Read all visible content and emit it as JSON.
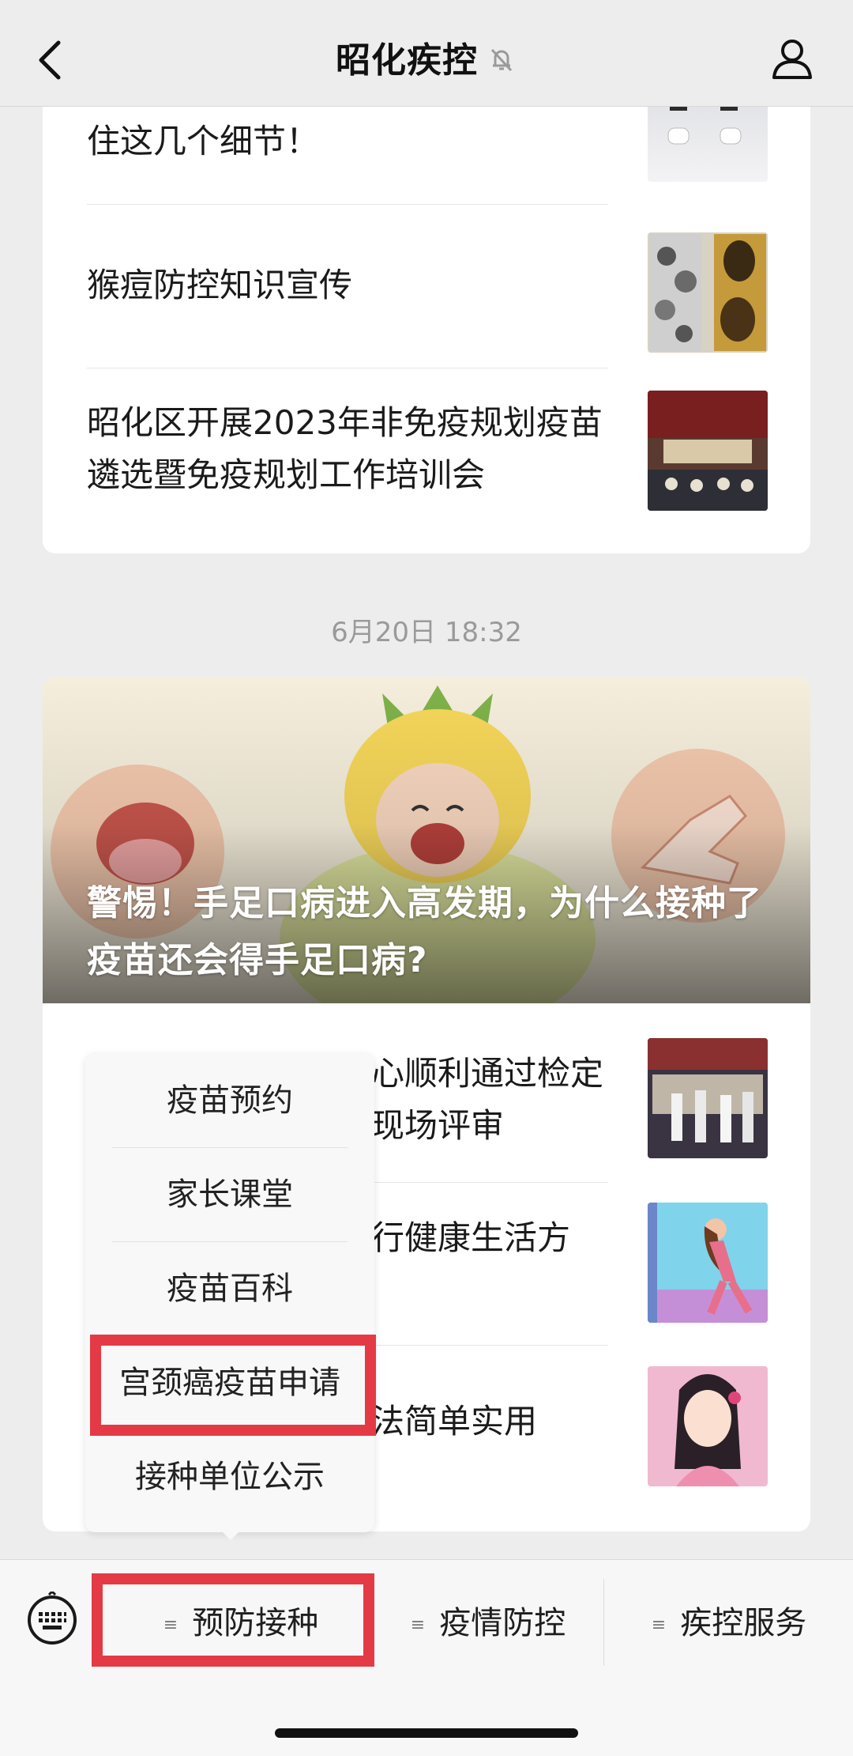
{
  "nav": {
    "title": "昭化疾控"
  },
  "articles_top": [
    {
      "title": "住这几个细节！"
    },
    {
      "title": "猴痘防控知识宣传"
    },
    {
      "title": "昭化区开展2023年非免疫规划疫苗遴选暨免疫规划工作培训会"
    }
  ],
  "timestamp": "6月20日 18:32",
  "hero": {
    "title": "警惕！手足口病进入高发期，为什么接种了疫苗还会得手足口病?"
  },
  "articles_bottom": [
    {
      "title_visible": "心顺利通过检定现场评审"
    },
    {
      "title_visible": "行健康生活方"
    },
    {
      "title_visible": "法简单实用"
    }
  ],
  "popup": {
    "items": [
      "疫苗预约",
      "家长课堂",
      "疫苗百科",
      "宫颈癌疫苗申请",
      "接种单位公示"
    ],
    "highlighted_index": 3
  },
  "bottom_menu": {
    "items": [
      "预防接种",
      "疫情防控",
      "疾控服务"
    ],
    "active_index": 0
  },
  "colors": {
    "highlight": "#e43a45",
    "background": "#ededed"
  }
}
